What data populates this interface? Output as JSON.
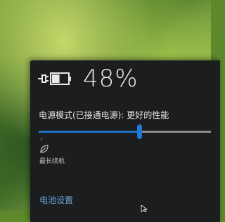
{
  "battery": {
    "percent_text": "48%",
    "level": 0.48,
    "icon": "battery-charging-icon"
  },
  "power_mode": {
    "label": "电源模式(已接通电源): 更好的性能",
    "slider_value": 0.59,
    "min_label": "最长续航",
    "min_icon": "leaf-icon"
  },
  "links": {
    "battery_settings": "电池设置"
  },
  "colors": {
    "accent": "#1f7ad6",
    "flyout_bg": "#1b1d1f",
    "link": "#68a6e0"
  }
}
